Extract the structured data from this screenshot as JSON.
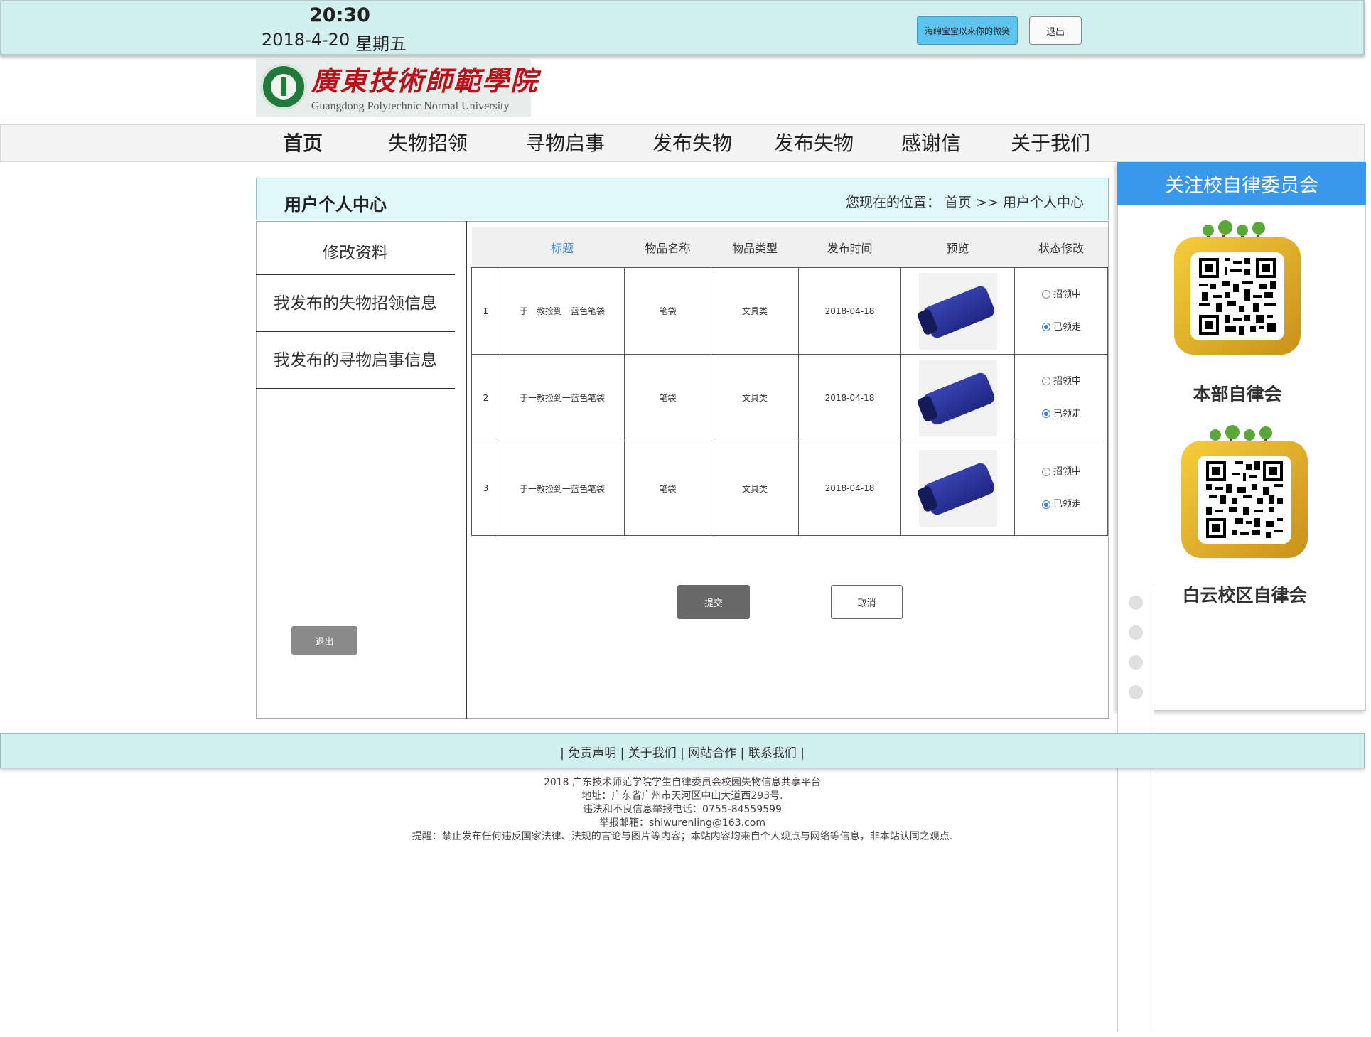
{
  "topbar": {
    "time": "20:30",
    "date": "2018-4-20",
    "weekday": "星期五",
    "user_button": "海绵宝宝以来你的微笑",
    "logout": "退出"
  },
  "logo": {
    "cn": "廣東技術師範學院",
    "en": "Guangdong Polytechnic Normal University"
  },
  "nav": [
    "首页",
    "失物招领",
    "寻物启事",
    "发布失物",
    "发布失物",
    "感谢信",
    "关于我们"
  ],
  "page": {
    "title": "用户个人中心",
    "breadcrumb": "您现在的位置：  首页 >> 用户个人中心"
  },
  "sidebar": {
    "items": [
      "修改资料",
      "我发布的失物招领信息",
      "我发布的寻物启事信息"
    ],
    "logout": "退出"
  },
  "table": {
    "headers": [
      "",
      "标题",
      "物品名称",
      "物品类型",
      "发布时间",
      "预览",
      "状态修改"
    ],
    "rows": [
      {
        "num": "1",
        "title": "于一教捡到一蓝色笔袋",
        "name": "笔袋",
        "type": "文具类",
        "date": "2018-04-18",
        "status_options": [
          "招领中",
          "已领走"
        ],
        "selected": "已领走"
      },
      {
        "num": "2",
        "title": "于一教捡到一蓝色笔袋",
        "name": "笔袋",
        "type": "文具类",
        "date": "2018-04-18",
        "status_options": [
          "招领中",
          "已领走"
        ],
        "selected": "已领走"
      },
      {
        "num": "3",
        "title": "于一教捡到一蓝色笔袋",
        "name": "笔袋",
        "type": "文具类",
        "date": "2018-04-18",
        "status_options": [
          "招领中",
          "已领走"
        ],
        "selected": "已领走"
      }
    ],
    "submit": "提交",
    "cancel": "取消"
  },
  "right_panel": {
    "header": "关注校自律委员会",
    "qr_labels": [
      "本部自律会",
      "白云校区自律会"
    ]
  },
  "footer": {
    "links": "| 免责声明 | 关于我们 | 网站合作 | 联系我们 |",
    "info": [
      "2018 广东技术师范学院学生自律委员会校园失物信息共享平台",
      "地址：广东省广州市天河区中山大道西293号.",
      "违法和不良信息举报电话：0755-84559599",
      "举报邮箱：shiwurenling@163.com",
      "提醒：禁止发布任何违反国家法律、法规的言论与图片等内容；本站内容均来自个人观点与网络等信息，非本站认同之观点."
    ]
  },
  "colors": {
    "topbar_bg": "#d2f0f0",
    "accent_blue": "#3a98ea",
    "user_button_bg": "#5cc4ee",
    "logo_red": "#b8111a"
  }
}
